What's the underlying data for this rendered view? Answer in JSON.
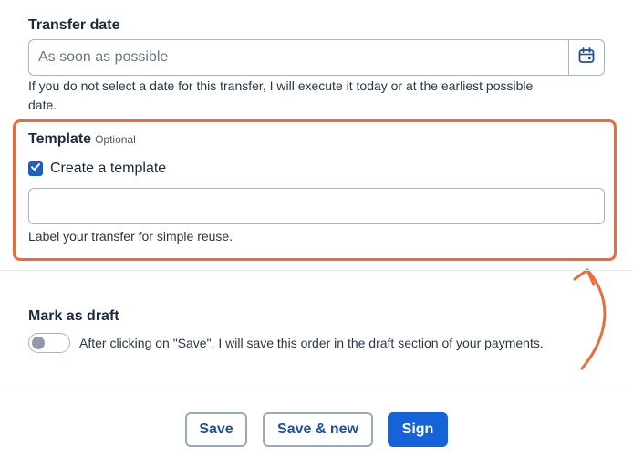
{
  "transfer_date": {
    "title": "Transfer date",
    "placeholder": "As soon as possible",
    "help_line1": "If you do not select a date for this transfer, I will execute it today or at the earliest possible",
    "help_line2": "date."
  },
  "template": {
    "title": "Template",
    "optional": "Optional",
    "checkbox_label": "Create a template",
    "checked": true,
    "input_value": "",
    "help": "Label your transfer for simple reuse."
  },
  "draft": {
    "title": "Mark as draft",
    "toggle_on": false,
    "description": "After clicking on \"Save\", I will save this order in the draft section of your payments."
  },
  "actions": {
    "save": "Save",
    "save_new": "Save & new",
    "sign": "Sign"
  },
  "colors": {
    "highlight": "#ef6a3a",
    "primary": "#1463d8",
    "text": "#1c2a3c"
  }
}
